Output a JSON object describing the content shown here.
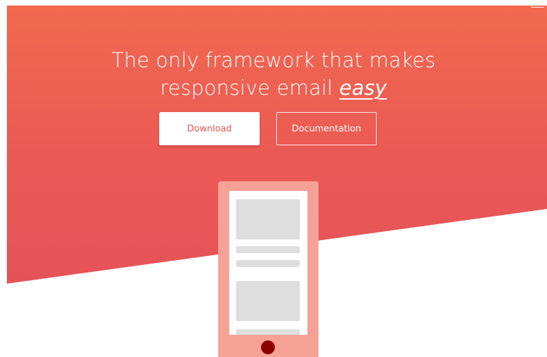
{
  "hero": {
    "headline_line1": "The only framework that makes",
    "headline_line2_prefix": "responsive email ",
    "headline_emphasis": "easy"
  },
  "buttons": {
    "download_label": "Download",
    "documentation_label": "Documentation"
  },
  "colors": {
    "gradient_top": "#f26a4f",
    "gradient_bottom": "#e24f5c",
    "phone_body": "#f6a196",
    "placeholder_block": "#dedede",
    "home_button": "#8b0000",
    "download_text": "#e5564a"
  },
  "icons": {
    "phone_home_button": "phone-home-button-icon",
    "phone_illustration": "phone-illustration"
  }
}
